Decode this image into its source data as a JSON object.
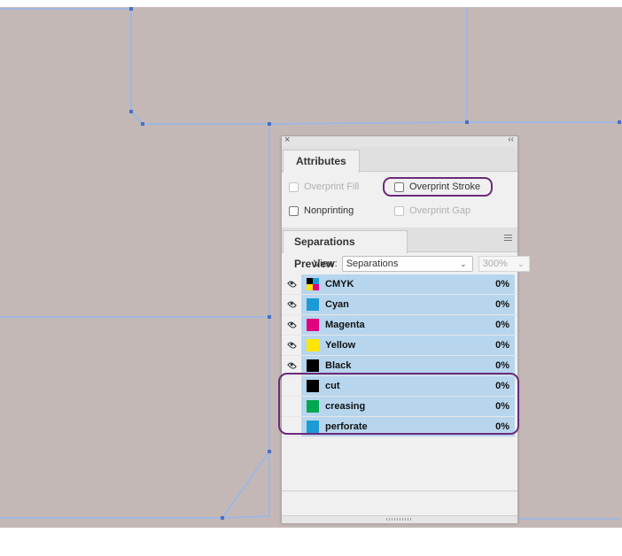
{
  "attributes_panel": {
    "tab": "Attributes",
    "overprint_fill": "Overprint Fill",
    "overprint_stroke": "Overprint Stroke",
    "nonprinting": "Nonprinting",
    "overprint_gap": "Overprint Gap"
  },
  "separations_panel": {
    "tab": "Separations Preview",
    "view_label": "View:",
    "view_value": "Separations",
    "zoom_value": "300%",
    "rows": [
      {
        "name": "CMYK",
        "pct": "0%",
        "eye": true,
        "swatch": "cmyk"
      },
      {
        "name": "Cyan",
        "pct": "0%",
        "eye": true,
        "swatch": "#1d9ad6"
      },
      {
        "name": "Magenta",
        "pct": "0%",
        "eye": true,
        "swatch": "#e3007e"
      },
      {
        "name": "Yellow",
        "pct": "0%",
        "eye": true,
        "swatch": "#ffe500"
      },
      {
        "name": "Black",
        "pct": "0%",
        "eye": true,
        "swatch": "#000000"
      },
      {
        "name": "cut",
        "pct": "0%",
        "eye": false,
        "swatch": "#000000"
      },
      {
        "name": "creasing",
        "pct": "0%",
        "eye": false,
        "swatch": "#00a650"
      },
      {
        "name": "perforate",
        "pct": "0%",
        "eye": false,
        "swatch": "#1d9ad6"
      }
    ]
  },
  "colors": {
    "highlight": "#6b2a7a",
    "row_selected": "#b7d6ee",
    "artboard": "#c4b8b7",
    "guide": "#9fb7e0"
  }
}
